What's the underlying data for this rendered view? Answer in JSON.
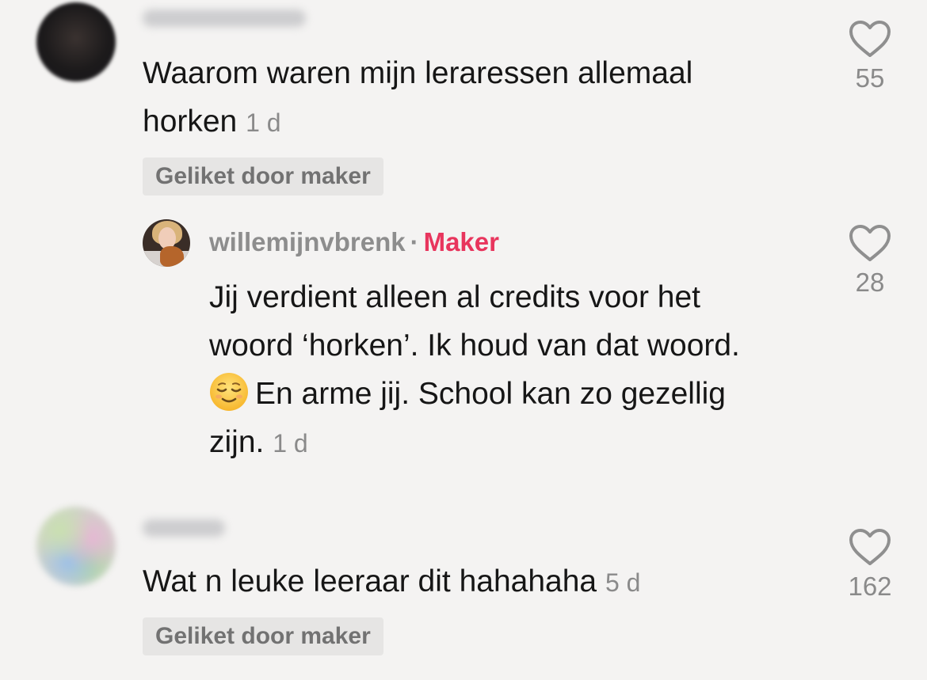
{
  "comments": [
    {
      "text_line1": "Waarom waren mijn leraressen allemaal",
      "text_line2": "horken",
      "time": "1 d",
      "liked_by_creator": "Geliket door maker",
      "likes": "55",
      "reply": {
        "username": "willemijnvbrenk",
        "separator": "·",
        "badge": "Maker",
        "line1": "Jij verdient alleen al credits voor het",
        "line2": "woord ‘horken’. Ik houd van dat woord.",
        "line3": "En arme jij. School kan zo gezellig",
        "line4": "zijn.",
        "time": "1 d",
        "likes": "28"
      }
    },
    {
      "text_line1": "Wat n leuke leeraar dit hahahaha",
      "time": "5 d",
      "liked_by_creator": "Geliket door maker",
      "likes": "162"
    }
  ],
  "icons": {
    "like": "heart-outline-icon",
    "emoji": "relieved-face-emoji"
  },
  "colors": {
    "background": "#f4f3f2",
    "maker_badge": "#e8355d",
    "secondary_text": "#8a8a8a"
  }
}
